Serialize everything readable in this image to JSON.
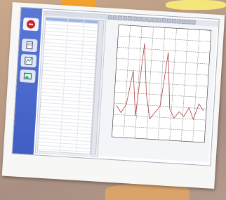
{
  "sidebar": {
    "top_icon": "close-circle-icon",
    "section_label": "",
    "buttons": [
      "document-icon",
      "chart-icon",
      "image-icon"
    ]
  },
  "list_panel": {
    "header": "",
    "row_count": 38,
    "selected_row": 0
  },
  "toolbar": {
    "icon_count": 18
  },
  "chart_data": {
    "type": "line",
    "xlabel": "",
    "ylabel": "",
    "ylim": [
      0,
      100
    ],
    "grid": true,
    "series": [
      {
        "values": [
          28,
          22,
          30,
          60,
          20,
          85,
          40,
          18,
          24,
          30,
          78,
          28,
          20,
          26,
          22,
          30,
          20,
          34,
          28
        ]
      }
    ],
    "colors": {
      "line": "#b04040",
      "grid": "#5a5a5a"
    }
  }
}
